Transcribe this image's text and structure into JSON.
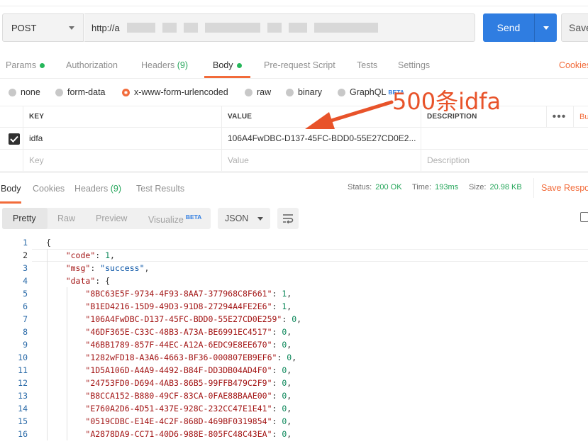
{
  "request": {
    "method": "POST",
    "url_visible": "http://a",
    "send_label": "Send",
    "save_label": "Save"
  },
  "tabs": [
    {
      "label": "Params",
      "dot": true
    },
    {
      "label": "Authorization"
    },
    {
      "label": "Headers",
      "count": "(9)"
    },
    {
      "label": "Body",
      "dot": true,
      "active": true
    },
    {
      "label": "Pre-request Script"
    },
    {
      "label": "Tests"
    },
    {
      "label": "Settings"
    }
  ],
  "cookies_label": "Cookies",
  "body_types": [
    {
      "label": "none"
    },
    {
      "label": "form-data"
    },
    {
      "label": "x-www-form-urlencoded",
      "selected": true
    },
    {
      "label": "raw"
    },
    {
      "label": "binary"
    },
    {
      "label": "GraphQL",
      "badge": "BETA"
    }
  ],
  "annotation": "500条idfa",
  "params_table": {
    "headers": {
      "key": "KEY",
      "value": "VALUE",
      "description": "DESCRIPTION",
      "bulk": "Bu"
    },
    "rows": [
      {
        "checked": true,
        "key": "idfa",
        "value": "106A4FwDBC-D137-45FC-BDD0-55E27CD0E2...",
        "description": ""
      }
    ],
    "placeholders": {
      "key": "Key",
      "value": "Value",
      "description": "Description"
    }
  },
  "response": {
    "tabs": [
      {
        "label": "Body",
        "active": true
      },
      {
        "label": "Cookies"
      },
      {
        "label": "Headers",
        "count": "(9)"
      },
      {
        "label": "Test Results"
      }
    ],
    "status_label": "Status:",
    "status_value": "200 OK",
    "time_label": "Time:",
    "time_value": "193ms",
    "size_label": "Size:",
    "size_value": "20.98 KB",
    "save_response": "Save Respon"
  },
  "viewer": {
    "modes": [
      "Pretty",
      "Raw",
      "Preview",
      "Visualize"
    ],
    "visualize_badge": "BETA",
    "format": "JSON"
  },
  "code_lines": [
    {
      "n": "1",
      "parts": [
        [
          "p",
          "{"
        ]
      ]
    },
    {
      "n": "2",
      "parts": [
        [
          "i",
          "    "
        ],
        [
          "k",
          "\"code\""
        ],
        [
          "p",
          ": "
        ],
        [
          "n",
          "1"
        ],
        [
          "p",
          ","
        ]
      ]
    },
    {
      "n": "3",
      "parts": [
        [
          "i",
          "    "
        ],
        [
          "k",
          "\"msg\""
        ],
        [
          "p",
          ": "
        ],
        [
          "s",
          "\"success\""
        ],
        [
          "p",
          ","
        ]
      ]
    },
    {
      "n": "4",
      "parts": [
        [
          "i",
          "    "
        ],
        [
          "k",
          "\"data\""
        ],
        [
          "p",
          ": {"
        ]
      ]
    },
    {
      "n": "5",
      "parts": [
        [
          "i",
          "        "
        ],
        [
          "k",
          "\"8BC63E5F-9734-4F93-8AA7-377968C8F661\""
        ],
        [
          "p",
          ": "
        ],
        [
          "n",
          "1"
        ],
        [
          "p",
          ","
        ]
      ]
    },
    {
      "n": "6",
      "parts": [
        [
          "i",
          "        "
        ],
        [
          "k",
          "\"B1ED4216-15D9-49D3-91D8-27294A4FE2E6\""
        ],
        [
          "p",
          ": "
        ],
        [
          "n",
          "1"
        ],
        [
          "p",
          ","
        ]
      ]
    },
    {
      "n": "7",
      "parts": [
        [
          "i",
          "        "
        ],
        [
          "k",
          "\"106A4FwDBC-D137-45FC-BDD0-55E27CD0E259\""
        ],
        [
          "p",
          ": "
        ],
        [
          "n",
          "0"
        ],
        [
          "p",
          ","
        ]
      ]
    },
    {
      "n": "8",
      "parts": [
        [
          "i",
          "        "
        ],
        [
          "k",
          "\"46DF365E-C33C-48B3-A73A-BE6991EC4517\""
        ],
        [
          "p",
          ": "
        ],
        [
          "n",
          "0"
        ],
        [
          "p",
          ","
        ]
      ]
    },
    {
      "n": "9",
      "parts": [
        [
          "i",
          "        "
        ],
        [
          "k",
          "\"46BB1789-857F-44EC-A12A-6EDC9E8EE670\""
        ],
        [
          "p",
          ": "
        ],
        [
          "n",
          "0"
        ],
        [
          "p",
          ","
        ]
      ]
    },
    {
      "n": "10",
      "parts": [
        [
          "i",
          "        "
        ],
        [
          "k",
          "\"1282wFD18-A3A6-4663-BF36-000807EB9EF6\""
        ],
        [
          "p",
          ": "
        ],
        [
          "n",
          "0"
        ],
        [
          "p",
          ","
        ]
      ]
    },
    {
      "n": "11",
      "parts": [
        [
          "i",
          "        "
        ],
        [
          "k",
          "\"1D5A106D-A4A9-4492-B84F-DD3DB04AD4F0\""
        ],
        [
          "p",
          ": "
        ],
        [
          "n",
          "0"
        ],
        [
          "p",
          ","
        ]
      ]
    },
    {
      "n": "12",
      "parts": [
        [
          "i",
          "        "
        ],
        [
          "k",
          "\"24753FD0-D694-4AB3-86B5-99FFB479C2F9\""
        ],
        [
          "p",
          ": "
        ],
        [
          "n",
          "0"
        ],
        [
          "p",
          ","
        ]
      ]
    },
    {
      "n": "13",
      "parts": [
        [
          "i",
          "        "
        ],
        [
          "k",
          "\"B8CCA152-B880-49CF-83CA-0FAE88BAAE00\""
        ],
        [
          "p",
          ": "
        ],
        [
          "n",
          "0"
        ],
        [
          "p",
          ","
        ]
      ]
    },
    {
      "n": "14",
      "parts": [
        [
          "i",
          "        "
        ],
        [
          "k",
          "\"E760A2D6-4D51-437E-928C-232CC47E1E41\""
        ],
        [
          "p",
          ": "
        ],
        [
          "n",
          "0"
        ],
        [
          "p",
          ","
        ]
      ]
    },
    {
      "n": "15",
      "parts": [
        [
          "i",
          "        "
        ],
        [
          "k",
          "\"0519CDBC-E14E-4C2F-868D-469BF0319854\""
        ],
        [
          "p",
          ": "
        ],
        [
          "n",
          "0"
        ],
        [
          "p",
          ","
        ]
      ]
    },
    {
      "n": "16",
      "parts": [
        [
          "i",
          "        "
        ],
        [
          "k",
          "\"A2878DA9-CC71-40D6-988E-805FC48C43EA\""
        ],
        [
          "p",
          ": "
        ],
        [
          "n",
          "0"
        ],
        [
          "p",
          ","
        ]
      ]
    }
  ],
  "colors": {
    "accent": "#f26b3a",
    "primary": "#2f7de1",
    "success": "#26a65b",
    "annotation": "#e8532a"
  },
  "icons": {
    "check": "check-icon",
    "menu": "more-horizontal-icon",
    "wrap": "wrap-lines-icon",
    "copy": "copy-icon"
  }
}
